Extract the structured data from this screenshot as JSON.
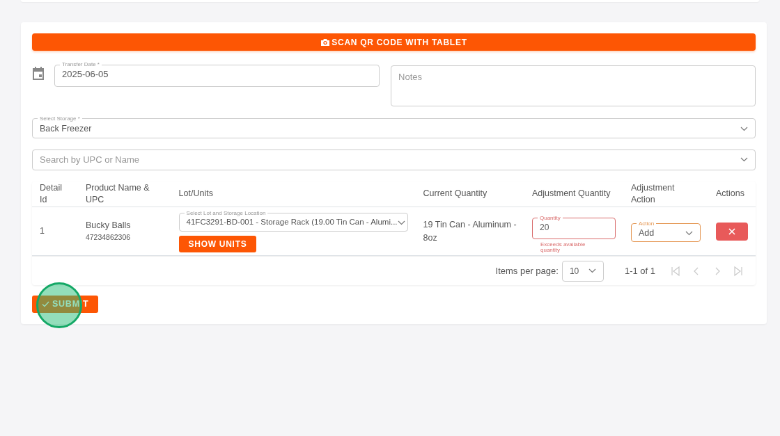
{
  "scan_button": {
    "label": "SCAN QR CODE WITH TABLET"
  },
  "transfer_date": {
    "label": "Transfer Date *",
    "value": "2025-06-05"
  },
  "notes": {
    "placeholder": "Notes"
  },
  "storage": {
    "label": "Select Storage *",
    "value": "Back Freezer"
  },
  "search": {
    "placeholder": "Search by UPC or Name"
  },
  "table": {
    "columns": [
      "Detail Id",
      "Product Name & UPC",
      "Lot/Units",
      "Current Quantity",
      "Adjustment Quantity",
      "Adjustment Action",
      "Actions"
    ],
    "rows": [
      {
        "detail_id": "1",
        "product_name": "Bucky Balls",
        "upc": "47234862306",
        "lot": {
          "label": "Select Lot and Storage Location",
          "value": "41FC3291-BD-001 - Storage Rack (19.00 Tin Can - Alumi..."
        },
        "units_button": "SHOW UNITS",
        "current_quantity": "19 Tin Can - Aluminum - 8oz",
        "quantity": {
          "label": "Quantity",
          "value": "20",
          "error": "Exceeds available quantity"
        },
        "action": {
          "label": "Action",
          "value": "Add"
        }
      }
    ]
  },
  "paginator": {
    "items_per_page_label": "Items per page:",
    "page_size": "10",
    "range": "1-1 of 1",
    "buttons": [
      {
        "kind": "first",
        "disabled": true
      },
      {
        "kind": "previous",
        "disabled": true
      },
      {
        "kind": "next",
        "disabled": true
      },
      {
        "kind": "last",
        "disabled": true
      }
    ]
  },
  "submit_button": {
    "label": "SUBMIT"
  }
}
